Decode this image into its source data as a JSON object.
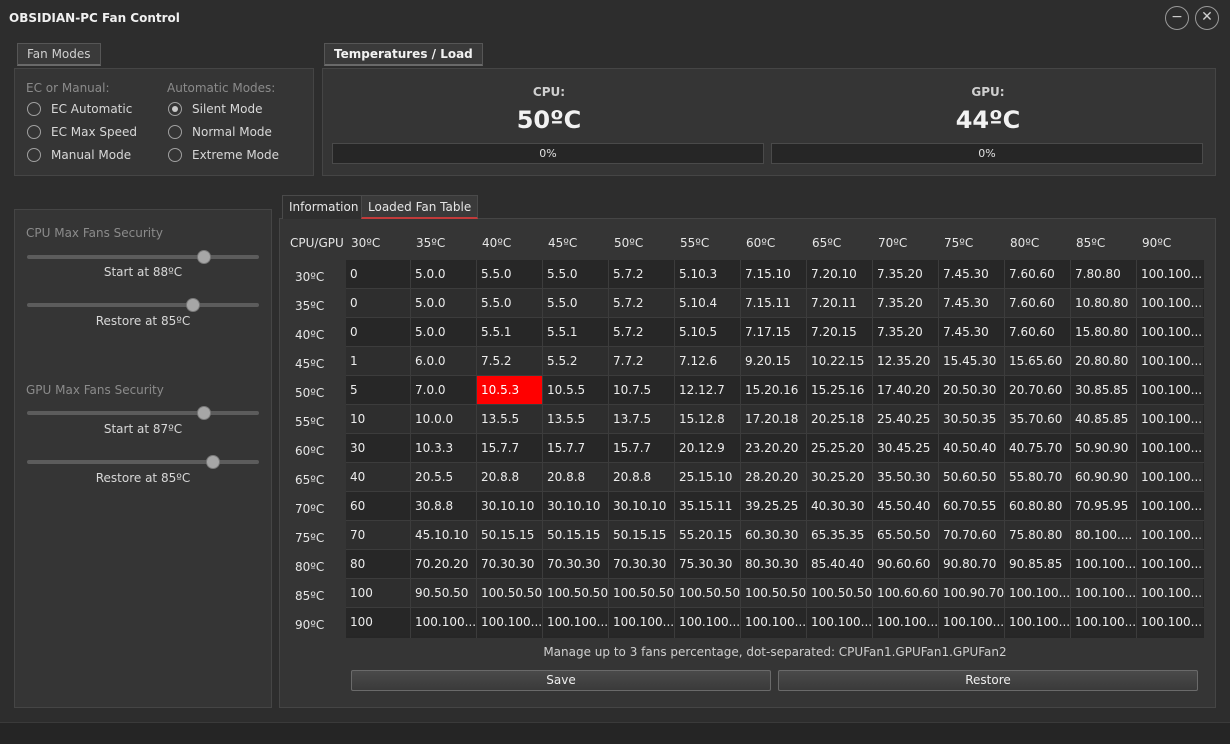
{
  "window": {
    "title": "OBSIDIAN-PC Fan Control",
    "minimize_glyph": "−",
    "close_glyph": "✕"
  },
  "fan_modes": {
    "tab_label": "Fan Modes",
    "ec_group_label": "EC or Manual:",
    "auto_group_label": "Automatic Modes:",
    "ec_options": [
      {
        "label": "EC Automatic",
        "checked": false
      },
      {
        "label": "EC Max Speed",
        "checked": false
      },
      {
        "label": "Manual Mode",
        "checked": false
      }
    ],
    "auto_options": [
      {
        "label": "Silent Mode",
        "checked": true
      },
      {
        "label": "Normal Mode",
        "checked": false
      },
      {
        "label": "Extreme Mode",
        "checked": false
      }
    ]
  },
  "temps": {
    "tab_label": "Temperatures / Load",
    "cpu": {
      "label": "CPU:",
      "value": "50ºC",
      "load_text": "0%",
      "load_fraction": 0
    },
    "gpu": {
      "label": "GPU:",
      "value": "44ºC",
      "load_text": "0%",
      "load_fraction": 0
    }
  },
  "security": {
    "cpu_title": "CPU Max Fans Security",
    "cpu_start_label": "Start at 88ºC",
    "cpu_start_fraction": 0.78,
    "cpu_restore_label": "Restore at 85ºC",
    "cpu_restore_fraction": 0.73,
    "gpu_title": "GPU Max Fans Security",
    "gpu_start_label": "Start at 87ºC",
    "gpu_start_fraction": 0.78,
    "gpu_restore_label": "Restore at 85ºC",
    "gpu_restore_fraction": 0.82
  },
  "tabs": {
    "information": "Information",
    "loaded_fan_table": "Loaded Fan Table"
  },
  "fan_table": {
    "corner_label": "CPU/GPU",
    "gpu_temps": [
      "30ºC",
      "35ºC",
      "40ºC",
      "45ºC",
      "50ºC",
      "55ºC",
      "60ºC",
      "65ºC",
      "70ºC",
      "75ºC",
      "80ºC",
      "85ºC",
      "90ºC"
    ],
    "cpu_temps": [
      "30ºC",
      "35ºC",
      "40ºC",
      "45ºC",
      "50ºC",
      "55ºC",
      "60ºC",
      "65ºC",
      "70ºC",
      "75ºC",
      "80ºC",
      "85ºC",
      "90ºC"
    ],
    "selected_row": 4,
    "selected_col": 2,
    "rows": [
      [
        "0",
        "5.0.0",
        "5.5.0",
        "5.5.0",
        "5.7.2",
        "5.10.3",
        "7.15.10",
        "7.20.10",
        "7.35.20",
        "7.45.30",
        "7.60.60",
        "7.80.80",
        "100.100..."
      ],
      [
        "0",
        "5.0.0",
        "5.5.0",
        "5.5.0",
        "5.7.2",
        "5.10.4",
        "7.15.11",
        "7.20.11",
        "7.35.20",
        "7.45.30",
        "7.60.60",
        "10.80.80",
        "100.100..."
      ],
      [
        "0",
        "5.0.0",
        "5.5.1",
        "5.5.1",
        "5.7.2",
        "5.10.5",
        "7.17.15",
        "7.20.15",
        "7.35.20",
        "7.45.30",
        "7.60.60",
        "15.80.80",
        "100.100..."
      ],
      [
        "1",
        "6.0.0",
        "7.5.2",
        "5.5.2",
        "7.7.2",
        "7.12.6",
        "9.20.15",
        "10.22.15",
        "12.35.20",
        "15.45.30",
        "15.65.60",
        "20.80.80",
        "100.100..."
      ],
      [
        "5",
        "7.0.0",
        "10.5.3",
        "10.5.5",
        "10.7.5",
        "12.12.7",
        "15.20.16",
        "15.25.16",
        "17.40.20",
        "20.50.30",
        "20.70.60",
        "30.85.85",
        "100.100..."
      ],
      [
        "10",
        "10.0.0",
        "13.5.5",
        "13.5.5",
        "13.7.5",
        "15.12.8",
        "17.20.18",
        "20.25.18",
        "25.40.25",
        "30.50.35",
        "35.70.60",
        "40.85.85",
        "100.100..."
      ],
      [
        "30",
        "10.3.3",
        "15.7.7",
        "15.7.7",
        "15.7.7",
        "20.12.9",
        "23.20.20",
        "25.25.20",
        "30.45.25",
        "40.50.40",
        "40.75.70",
        "50.90.90",
        "100.100..."
      ],
      [
        "40",
        "20.5.5",
        "20.8.8",
        "20.8.8",
        "20.8.8",
        "25.15.10",
        "28.20.20",
        "30.25.20",
        "35.50.30",
        "50.60.50",
        "55.80.70",
        "60.90.90",
        "100.100..."
      ],
      [
        "60",
        "30.8.8",
        "30.10.10",
        "30.10.10",
        "30.10.10",
        "35.15.11",
        "39.25.25",
        "40.30.30",
        "45.50.40",
        "60.70.55",
        "60.80.80",
        "70.95.95",
        "100.100..."
      ],
      [
        "70",
        "45.10.10",
        "50.15.15",
        "50.15.15",
        "50.15.15",
        "55.20.15",
        "60.30.30",
        "65.35.35",
        "65.50.50",
        "70.70.60",
        "75.80.80",
        "80.100....",
        "100.100..."
      ],
      [
        "80",
        "70.20.20",
        "70.30.30",
        "70.30.30",
        "70.30.30",
        "75.30.30",
        "80.30.30",
        "85.40.40",
        "90.60.60",
        "90.80.70",
        "90.85.85",
        "100.100...",
        "100.100..."
      ],
      [
        "100",
        "90.50.50",
        "100.50.50",
        "100.50.50",
        "100.50.50",
        "100.50.50",
        "100.50.50",
        "100.50.50",
        "100.60.60",
        "100.90.70",
        "100.100...",
        "100.100...",
        "100.100..."
      ],
      [
        "100",
        "100.100...",
        "100.100...",
        "100.100...",
        "100.100...",
        "100.100...",
        "100.100...",
        "100.100...",
        "100.100...",
        "100.100...",
        "100.100...",
        "100.100...",
        "100.100..."
      ]
    ],
    "hint": "Manage up to 3 fans percentage, dot-separated: CPUFan1.GPUFan1.GPUFan2",
    "save_label": "Save",
    "restore_label": "Restore"
  }
}
